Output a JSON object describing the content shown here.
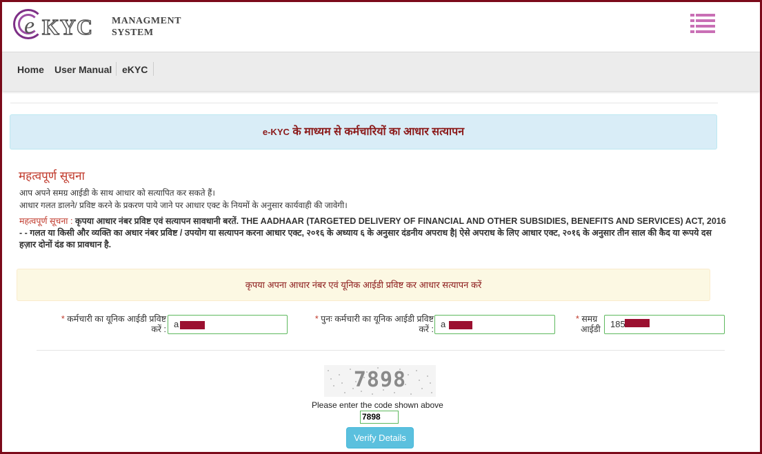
{
  "brand": {
    "logo_e": "e",
    "logo_kyc": "KYC",
    "line1": "MANAGMENT",
    "line2": "SYSTEM"
  },
  "nav": {
    "home": "Home",
    "user_manual": "User Manual",
    "ekyc": "eKYC"
  },
  "banner": {
    "prefix": "e-KYC",
    "text": " के माध्यम से कर्मचारियों का आधार सत्यापन"
  },
  "notice": {
    "title": "महत्वपूर्ण सूचना",
    "line1": "आप अपने समग्र आईडी के साथ आधार को सत्यापित कर सकते हैं।",
    "line2": "आधार गलत डालने/ प्रविष्ट करने के प्रकरण पाये जाने पर आधार एक्ट के नियमों के अनुसार कार्यवाही की जावेगी।",
    "para_label": "महत्वपूर्ण सूचना : ",
    "para_text": "कृपया आधार नंबर प्रविष्ट एवं सत्यापन सावधानी बरतें. THE AADHAAR (TARGETED DELIVERY OF FINANCIAL AND OTHER SUBSIDIES, BENEFITS AND SERVICES) ACT, 2016 - - गलत या किसी और व्यक्ति का अधार नंबर प्रविष्ट / उपयोग या सत्यापन करना आधार एक्ट, २०१६ के अध्याय ६ के अनुसार दंडनीय अपराध है| ऐसे अपराध के लिए आधार एक्ट, २०१६ के अनुसार तीन साल की कैद या रूपये दस हज़ार दोनों दंड का प्रावधान है."
  },
  "warning": "कृपया अपना आधार नंबर एवं यूनिक आईडी प्रविष्ट कर आधार सत्यापन करें",
  "form": {
    "required_mark": "*",
    "field1": {
      "label_line1": "कर्मचारी का यूनिक आईडी प्रविष्ट",
      "label_line2": "करें :",
      "value": "a"
    },
    "field2": {
      "label_line1": "पुनः कर्मचारी का यूनिक आईडी प्रविष्ट",
      "label_line2": "करें :",
      "value": "a"
    },
    "field3": {
      "label_line1": "समग्र",
      "label_line2": "आईडी",
      "value": "185"
    }
  },
  "captcha": {
    "code": "7898",
    "label": "Please enter the code shown above",
    "value": "7898"
  },
  "verify_button": "Verify Details",
  "colors": {
    "frame": "#7b0a1a",
    "menu_icon": "#c96fb5",
    "banner_bg": "#d9edf7",
    "warning_bg": "#fcf8e3",
    "button": "#5bc0de",
    "redaction": "#9b1030"
  }
}
